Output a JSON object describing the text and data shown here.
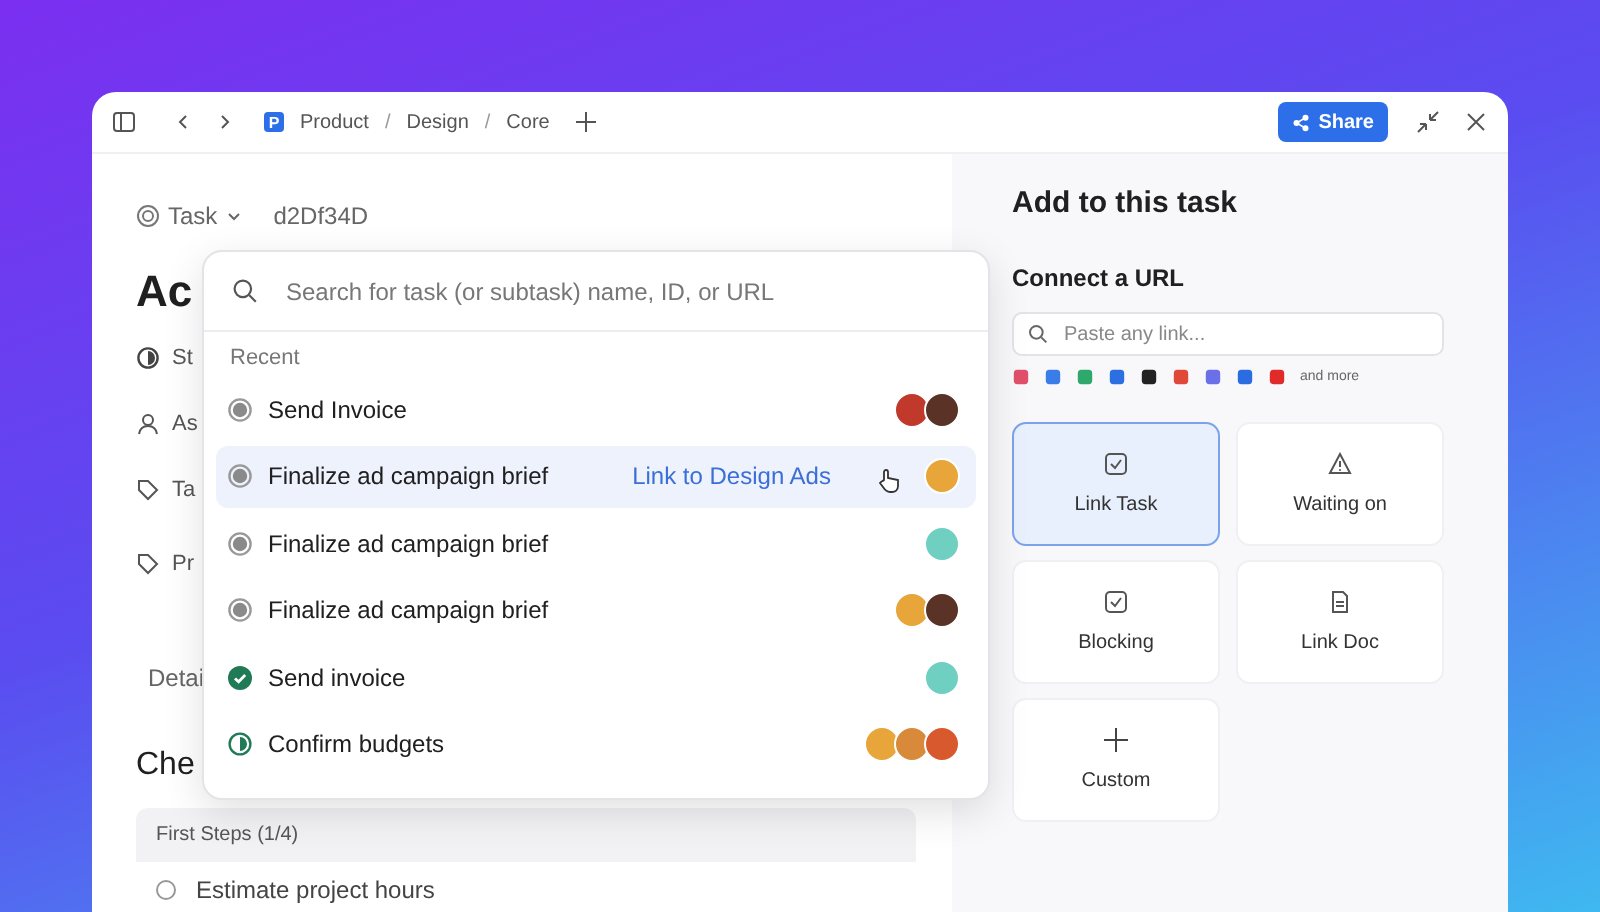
{
  "toolbar": {
    "space_badge": "P",
    "breadcrumbs": [
      {
        "label": "Product"
      },
      {
        "separator": "/",
        "label": "Design"
      },
      {
        "separator": "/",
        "label": "Core"
      }
    ],
    "share_button": "Share"
  },
  "task_header": {
    "type_label": "Task",
    "task_id": "d2Df34D"
  },
  "left_fragments": {
    "title": "Ac",
    "fields": [
      {
        "kind": "status",
        "label": "St"
      },
      {
        "kind": "assignee",
        "label": "As"
      },
      {
        "kind": "tag",
        "label": "Ta"
      },
      {
        "kind": "tag",
        "label": "Pr"
      }
    ],
    "details_tab": "Detai",
    "checklist_heading": "Che"
  },
  "checklist": {
    "group": "First Steps (1/4)",
    "items": [
      {
        "label": "Estimate project hours",
        "checked": false
      }
    ]
  },
  "search_popup": {
    "placeholder": "Search for task (or subtask) name, ID, or URL",
    "section": "Recent",
    "rows": [
      {
        "name": "Send Invoice",
        "kind": "todo",
        "selected": false,
        "avatars": [
          {
            "color": "#c0392b"
          },
          {
            "color": "#5a3326"
          }
        ]
      },
      {
        "name": "Finalize ad campaign brief",
        "kind": "todo",
        "selected": true,
        "action": "Link to Design Ads",
        "avatars": [
          {
            "color": "#e8a53a"
          }
        ]
      },
      {
        "name": "Finalize ad campaign brief",
        "kind": "todo",
        "selected": false,
        "avatars": [
          {
            "color": "#6fcfc0"
          }
        ]
      },
      {
        "name": "Finalize ad campaign brief",
        "kind": "todo",
        "selected": false,
        "avatars": [
          {
            "color": "#e8a53a"
          },
          {
            "color": "#5a3326"
          }
        ]
      },
      {
        "name": "Send invoice",
        "kind": "done",
        "selected": false,
        "avatars": [
          {
            "color": "#6fcfc0"
          }
        ]
      },
      {
        "name": "Confirm budgets",
        "kind": "in_progress",
        "selected": false,
        "avatars": [
          {
            "color": "#e8a53a"
          },
          {
            "color": "#d9893a"
          },
          {
            "color": "#d9592f"
          }
        ]
      }
    ]
  },
  "side_panel": {
    "title": "Add to this task",
    "url_heading": "Connect a URL",
    "url_placeholder": "Paste any link...",
    "integrations": [
      {
        "color": "#e0506a"
      },
      {
        "color": "#3b7de8"
      },
      {
        "color": "#2fa86b"
      },
      {
        "color": "#2c6fe0"
      },
      {
        "color": "#222222"
      },
      {
        "color": "#e0483a"
      },
      {
        "color": "#6b6fe8"
      },
      {
        "color": "#2b6de0"
      },
      {
        "color": "#e02b2b"
      }
    ],
    "more_label": "and more",
    "options": [
      {
        "label": "Link Task",
        "kind": "task",
        "selected": true
      },
      {
        "label": "Waiting on",
        "kind": "warning",
        "selected": false
      },
      {
        "label": "Blocking",
        "kind": "task",
        "selected": false
      },
      {
        "label": "Link Doc",
        "kind": "doc",
        "selected": false
      },
      {
        "label": "Custom",
        "kind": "plus",
        "selected": false
      }
    ]
  }
}
